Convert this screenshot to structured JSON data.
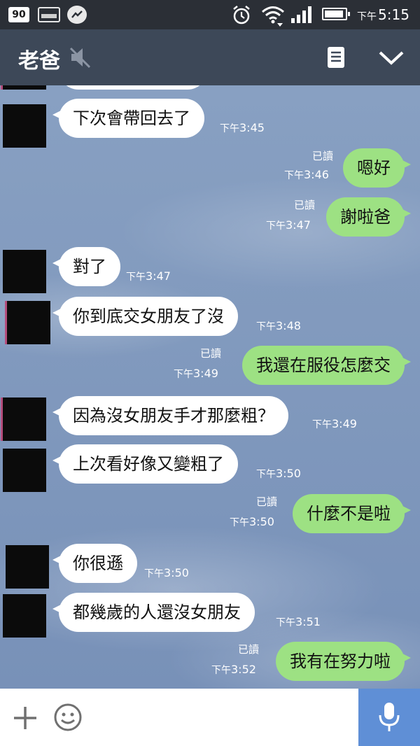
{
  "status_bar": {
    "badge": "90",
    "time_prefix": "下午",
    "time": "5:15"
  },
  "header": {
    "title": "老爸"
  },
  "icons": {
    "status": [
      "image-notification-icon",
      "messenger-icon",
      "alarm-icon",
      "wifi-icon",
      "signal-icon",
      "battery-icon"
    ],
    "header": [
      "mute-icon",
      "notes-icon",
      "chevron-down-icon"
    ],
    "input": [
      "plus-icon",
      "emoji-icon",
      "microphone-icon"
    ]
  },
  "colors": {
    "header_bg": "#3d4858",
    "incoming_bubble": "#ffffff",
    "outgoing_bubble": "#9de183",
    "mic_button": "#5f8fd6"
  },
  "messages": [
    {
      "dir": "in",
      "text": "下次會帶回去了",
      "time_prefix": "下午",
      "time": "3:45"
    },
    {
      "dir": "out",
      "read": "已讀",
      "text": "嗯好",
      "time_prefix": "下午",
      "time": "3:46"
    },
    {
      "dir": "out",
      "read": "已讀",
      "text": "謝啦爸",
      "time_prefix": "下午",
      "time": "3:47"
    },
    {
      "dir": "in",
      "text": "對了",
      "time_prefix": "下午",
      "time": "3:47"
    },
    {
      "dir": "in",
      "text": "你到底交女朋友了沒",
      "time_prefix": "下午",
      "time": "3:48"
    },
    {
      "dir": "out",
      "read": "已讀",
      "text": "我還在服役怎麼交",
      "time_prefix": "下午",
      "time": "3:49"
    },
    {
      "dir": "in",
      "text": "因為沒女朋友手才那麼粗？",
      "time_prefix": "下午",
      "time": "3:49"
    },
    {
      "dir": "in",
      "text": "上次看好像又變粗了",
      "time_prefix": "下午",
      "time": "3:50"
    },
    {
      "dir": "out",
      "read": "已讀",
      "text": "什麼不是啦",
      "time_prefix": "下午",
      "time": "3:50"
    },
    {
      "dir": "in",
      "text": "你很遜",
      "time_prefix": "下午",
      "time": "3:50"
    },
    {
      "dir": "in",
      "text": "都幾歲的人還沒女朋友",
      "time_prefix": "下午",
      "time": "3:51"
    },
    {
      "dir": "out",
      "read": "已讀",
      "text": "我有在努力啦",
      "time_prefix": "下午",
      "time": "3:52"
    }
  ]
}
